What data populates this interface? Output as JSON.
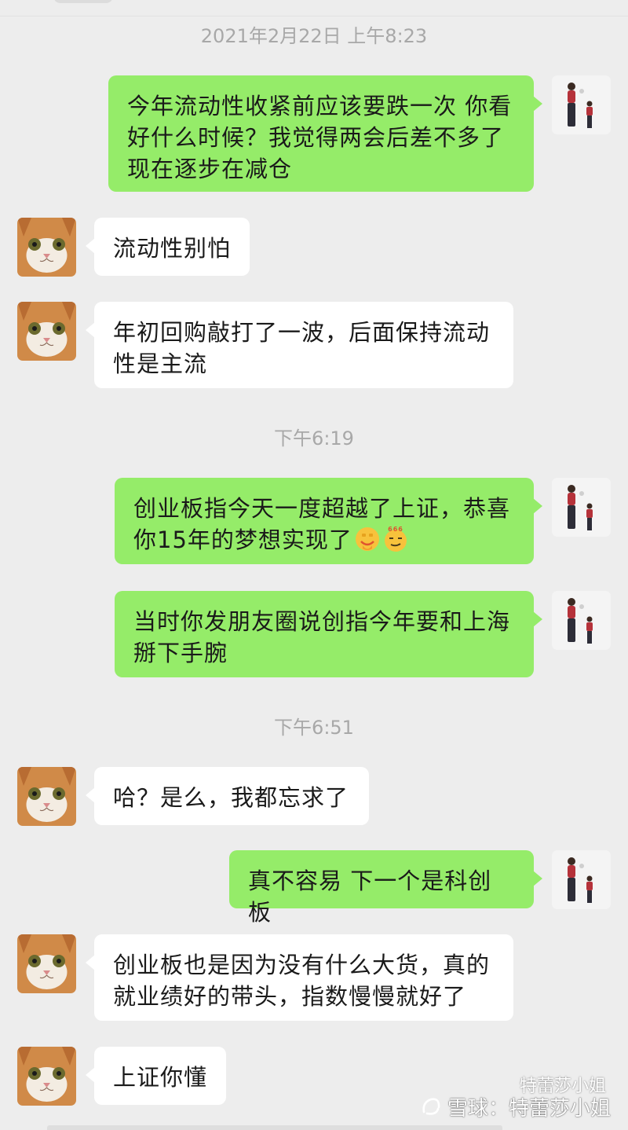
{
  "timestamps": {
    "t1": "2021年2月22日 上午8:23",
    "t2": "下午6:19",
    "t3": "下午6:51"
  },
  "messages": {
    "m1": "今年流动性收紧前应该要跌一次 你看好什么时候？我觉得两会后差不多了 现在逐步在减仓",
    "m2": "流动性别怕",
    "m3": "年初回购敲打了一波，后面保持流动性是主流",
    "m4": "创业板指今天一度超越了上证，恭喜你15年的梦想实现了",
    "m5": "当时你发朋友圈说创指今年要和上海掰下手腕",
    "m6": "哈？是么，我都忘求了",
    "m7": "真不容易 下一个是科创板",
    "m8": "创业板也是因为没有什么大货，真的就业绩好的带头，指数慢慢就好了",
    "m9": "上证你懂"
  },
  "emoji": {
    "e1": "666",
    "e1_icon": "fist-emoji-icon",
    "e2_icon": "smug-666-emoji-icon"
  },
  "avatars": {
    "incoming": "cat-avatar-icon",
    "outgoing": "figure-avatar-icon"
  },
  "watermark": {
    "top": "特蕾莎小姐",
    "bottom": "雪球：特蕾莎小姐"
  },
  "colors": {
    "background": "#ededed",
    "incoming_bubble": "#ffffff",
    "outgoing_bubble": "#95ec69",
    "timestamp": "#a8a8a8"
  }
}
